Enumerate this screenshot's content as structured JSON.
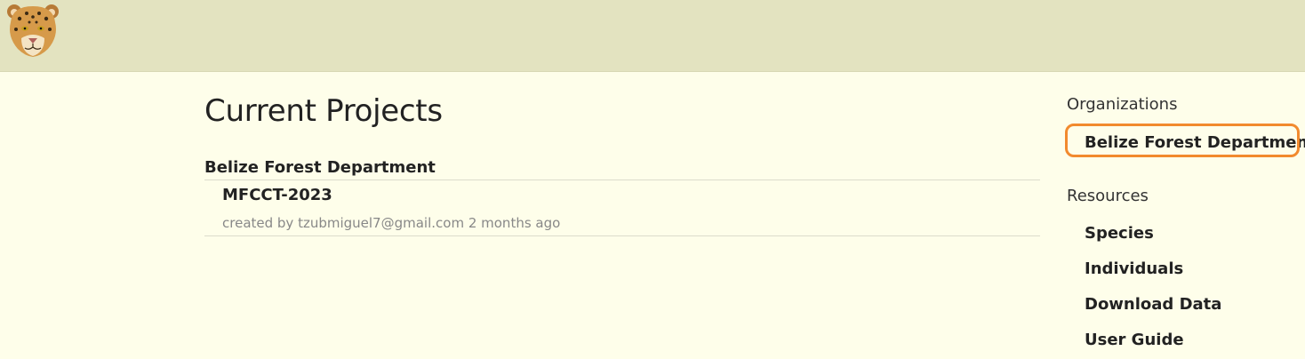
{
  "header": {
    "logo_icon": "jaguar-logo-icon"
  },
  "main": {
    "title": "Current Projects",
    "organization": "Belize Forest Department",
    "projects": [
      {
        "name": "MFCCT-2023",
        "meta": "created by tzubmiguel7@gmail.com 2 months ago"
      }
    ]
  },
  "sidebar": {
    "organizations_heading": "Organizations",
    "organizations": [
      "Belize Forest Department"
    ],
    "resources_heading": "Resources",
    "resources": [
      "Species",
      "Individuals",
      "Download Data",
      "User Guide"
    ]
  },
  "colors": {
    "header_bg": "#e3e3c0",
    "page_bg": "#fefeea",
    "highlight": "#f28a2e"
  }
}
